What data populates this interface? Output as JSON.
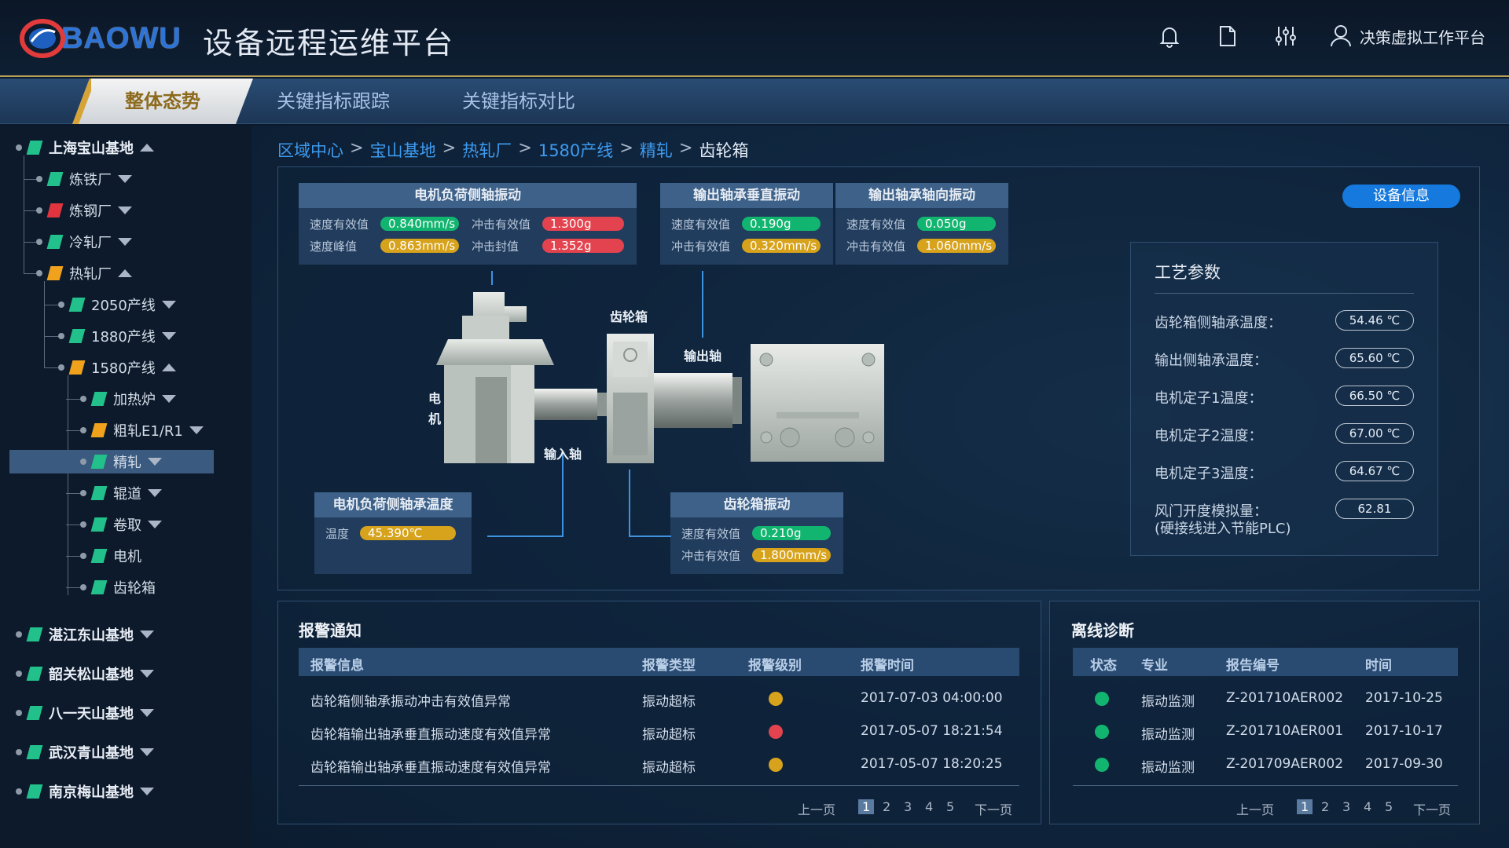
{
  "app": {
    "logo_text": "BAOWU",
    "title": "设备远程运维平台",
    "user": "决策虚拟工作平台"
  },
  "icons": {
    "bell": "bell-icon",
    "doc": "document-icon",
    "settings": "sliders-icon",
    "user": "user-icon"
  },
  "nav": {
    "tabs": [
      "整体态势",
      "关键指标跟踪",
      "关键指标对比"
    ],
    "active": 0
  },
  "tree": [
    {
      "label": "上海宝山基地",
      "level": 0,
      "flag": "#22c08a"
    },
    {
      "label": "炼铁厂",
      "level": 1,
      "flag": "#22c08a"
    },
    {
      "label": "炼钢厂",
      "level": 1,
      "flag": "#e2343e"
    },
    {
      "label": "冷轧厂",
      "level": 1,
      "flag": "#22c08a"
    },
    {
      "label": "热轧厂",
      "level": 1,
      "flag": "#f0a21c"
    },
    {
      "label": "2050产线",
      "level": 2,
      "flag": "#22c08a"
    },
    {
      "label": "1880产线",
      "level": 2,
      "flag": "#22c08a"
    },
    {
      "label": "1580产线",
      "level": 2,
      "flag": "#f0a21c"
    },
    {
      "label": "加热炉",
      "level": 3,
      "flag": "#22c08a"
    },
    {
      "label": "粗轧E1/R1",
      "level": 3,
      "flag": "#f0a21c"
    },
    {
      "label": "精轧",
      "level": 3,
      "flag": "#22c08a"
    },
    {
      "label": "辊道",
      "level": 3,
      "flag": "#22c08a"
    },
    {
      "label": "卷取",
      "level": 3,
      "flag": "#22c08a"
    },
    {
      "label": "电机",
      "level": 3,
      "flag": "#22c08a"
    },
    {
      "label": "齿轮箱",
      "level": 3,
      "flag": "#22c08a"
    },
    {
      "label": "湛江东山基地",
      "level": 0,
      "flag": "#22c08a"
    },
    {
      "label": "韶关松山基地",
      "level": 0,
      "flag": "#22c08a"
    },
    {
      "label": "八一天山基地",
      "level": 0,
      "flag": "#22c08a"
    },
    {
      "label": "武汉青山基地",
      "level": 0,
      "flag": "#22c08a"
    },
    {
      "label": "南京梅山基地",
      "level": 0,
      "flag": "#22c08a"
    }
  ],
  "breadcrumb": [
    "区域中心",
    "宝山基地",
    "热轧厂",
    "1580产线",
    "精轧",
    "齿轮箱"
  ],
  "equip_info_button": "设备信息",
  "equip_labels": {
    "motor": "电机",
    "input_shaft": "输入轴",
    "gearbox": "齿轮箱",
    "output_shaft": "输出轴"
  },
  "metrics": {
    "motor_vib": {
      "title": "电机负荷侧轴振动",
      "rows": [
        {
          "label": "速度有效值",
          "value": "0.840mm/s",
          "status": "g",
          "label2": "冲击有效值",
          "value2": "1.300g",
          "status2": "r"
        },
        {
          "label": "速度峰值",
          "value": "0.863mm/s",
          "status": "y",
          "label2": "冲击封值",
          "value2": "1.352g",
          "status2": "r"
        }
      ]
    },
    "out_vert": {
      "title": "输出轴承垂直振动",
      "rows": [
        {
          "label": "速度有效值",
          "value": "0.190g",
          "status": "g"
        },
        {
          "label": "冲击有效值",
          "value": "0.320mm/s",
          "status": "y"
        }
      ]
    },
    "out_axial": {
      "title": "输出轴承轴向振动",
      "rows": [
        {
          "label": "速度有效值",
          "value": "0.050g",
          "status": "g"
        },
        {
          "label": "冲击有效值",
          "value": "1.060mm/s",
          "status": "y"
        }
      ]
    },
    "motor_temp": {
      "title": "电机负荷侧轴承温度",
      "rows": [
        {
          "label": "温度",
          "value": "45.390℃",
          "status": "y"
        }
      ]
    },
    "gear_vib": {
      "title": "齿轮箱振动",
      "rows": [
        {
          "label": "速度有效值",
          "value": "0.210g",
          "status": "g"
        },
        {
          "label": "冲击有效值",
          "value": "1.800mm/s",
          "status": "y"
        }
      ]
    }
  },
  "process": {
    "title": "工艺参数",
    "rows": [
      {
        "label": "齿轮箱侧轴承温度：",
        "value": "54.46 ℃"
      },
      {
        "label": "输出侧轴承温度：",
        "value": "65.60 ℃"
      },
      {
        "label": "电机定子1温度：",
        "value": "66.50 ℃"
      },
      {
        "label": "电机定子2温度：",
        "value": "67.00 ℃"
      },
      {
        "label": "电机定子3温度：",
        "value": "64.67 ℃"
      },
      {
        "label": "风门开度模拟量：",
        "label2": "(硬接线进入节能PLC)",
        "value": "62.81"
      }
    ]
  },
  "alarms": {
    "title": "报警通知",
    "headers": [
      "报警信息",
      "报警类型",
      "报警级别",
      "报警时间"
    ],
    "rows": [
      {
        "info": "齿轮箱侧轴承振动冲击有效值异常",
        "type": "振动超标",
        "level": "#d7a21c",
        "time": "2017-07-03 04:00:00"
      },
      {
        "info": "齿轮箱输出轴承垂直振动速度有效值异常",
        "type": "振动超标",
        "level": "#e2434e",
        "time": "2017-05-07 18:21:54"
      },
      {
        "info": "齿轮箱输出轴承垂直振动速度有效值异常",
        "type": "振动超标",
        "level": "#d7a21c",
        "time": "2017-05-07 18:20:25"
      }
    ],
    "pager": {
      "prev": "上一页",
      "pages": [
        "1",
        "2",
        "3",
        "4",
        "5"
      ],
      "next": "下一页"
    }
  },
  "offline": {
    "title": "离线诊断",
    "headers": [
      "状态",
      "专业",
      "报告编号",
      "时间"
    ],
    "rows": [
      {
        "status": "#12b56f",
        "major": "振动监测",
        "report": "Z-201710AER002",
        "time": "2017-10-25"
      },
      {
        "status": "#12b56f",
        "major": "振动监测",
        "report": "Z-201710AER001",
        "time": "2017-10-17"
      },
      {
        "status": "#12b56f",
        "major": "振动监测",
        "report": "Z-201709AER002",
        "time": "2017-09-30"
      }
    ],
    "pager": {
      "prev": "上一页",
      "pages": [
        "1",
        "2",
        "3",
        "4",
        "5"
      ],
      "next": "下一页"
    }
  }
}
